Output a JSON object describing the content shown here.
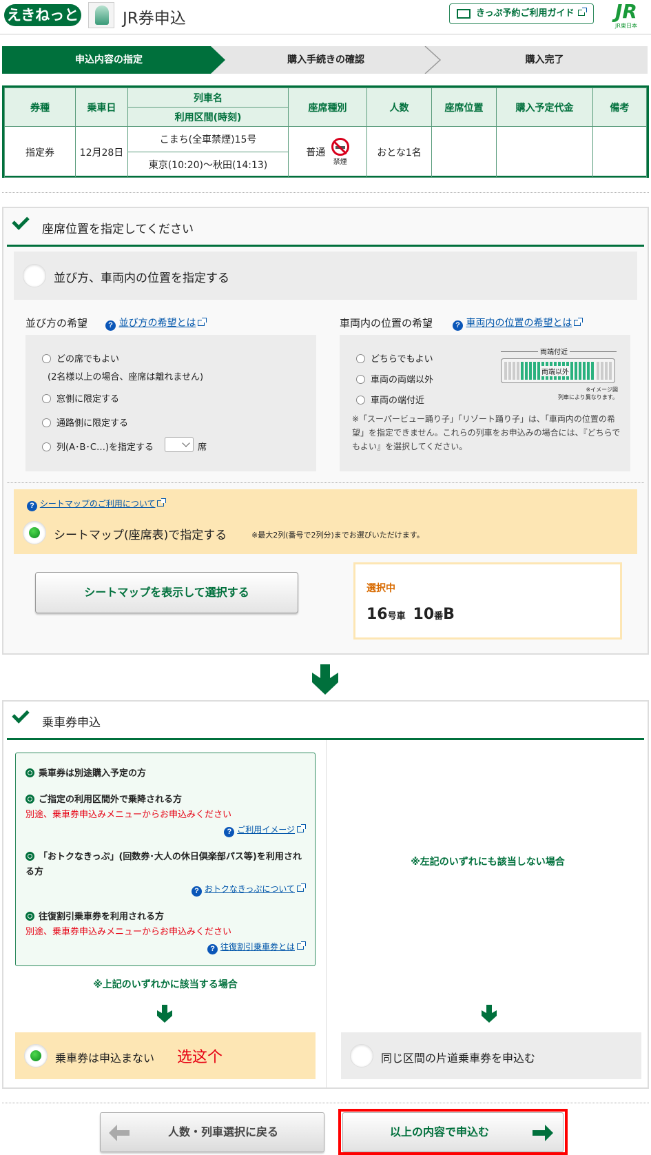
{
  "header": {
    "logo": "えきねっと",
    "title": "JR券申込",
    "guide_button": "きっぷ予約ご利用ガイド",
    "jr_logo": "JR",
    "jr_logo_sub": "JR東日本"
  },
  "steps": [
    "申込内容の指定",
    "購入手続きの確認",
    "購入完了"
  ],
  "ticket_table": {
    "headers": {
      "type": "券種",
      "date": "乗車日",
      "train": "列車名",
      "section": "利用区間(時刻)",
      "seat_class": "座席種別",
      "people": "人数",
      "seat_pos": "座席位置",
      "price": "購入予定代金",
      "note": "備考"
    },
    "row": {
      "type": "指定券",
      "date": "12月28日",
      "train": "こまち(全車禁煙)15号",
      "section": "東京(10:20)～秋田(14:13)",
      "seat_class": "普通",
      "smoking": "禁煙",
      "people": "おとな1名"
    }
  },
  "seat_section": {
    "title": "座席位置を指定してください",
    "option_arrange": "並び方、車両内の位置を指定する",
    "arrange_label": "並び方の希望",
    "arrange_link": "並び方の希望とは",
    "arrange_options": [
      "どの席でもよい",
      "(2名様以上の場合、座席は離れません)",
      "窓側に限定する",
      "通路側に限定する",
      "列(A･B･C…)を指定する"
    ],
    "seat_suffix": "席",
    "position_label": "車両内の位置の希望",
    "position_link": "車両内の位置の希望とは",
    "position_options": [
      "どちらでもよい",
      "車両の両端以外",
      "車両の端付近"
    ],
    "diagram_top": "両端付近",
    "diagram_mid": "両端以外",
    "diagram_note1": "※イメージ図",
    "diagram_note2": "列車により異なります。",
    "position_note": "※「スーパービュー踊り子」「リゾート踊り子」は、「車両内の位置の希望」を指定できません。これらの列車をお申込みの場合には、『どちらでもよい』を選択してください。",
    "seatmap_link": "シートマップのご利用について",
    "option_seatmap": "シートマップ(座席表)で指定する",
    "seatmap_note": "※最大2列(番号で2列分)までお選びいただけます。",
    "seatmap_button": "シートマップを表示して選択する",
    "selected_label": "選択中",
    "selected_car_num": "16",
    "selected_car_unit": "号車",
    "selected_seat_num": "10",
    "selected_seat_unit": "番",
    "selected_seat_letter": "B"
  },
  "ticket_section": {
    "title": "乗車券申込",
    "items": [
      {
        "text": "乗車券は別途購入予定の方"
      },
      {
        "text": "ご指定の利用区間外で乗降される方",
        "warn": "別途、乗車券申込みメニューからお申込みください",
        "link": "ご利用イメージ"
      },
      {
        "text": "「おトクなきっぷ」(回数券･大人の休日倶楽部パス等)を利用される方",
        "link": "おトクなきっぷについて"
      },
      {
        "text": "往復割引乗車券を利用される方",
        "warn": "別途、乗車券申込みメニューからお申込みください",
        "link": "往復割引乗車券とは"
      }
    ],
    "left_caption": "※上記のいずれかに該当する場合",
    "right_caption": "※左記のいずれにも該当しない場合",
    "option_no": "乗車券は申込まない",
    "annotation": "选这个",
    "option_yes": "同じ区間の片道乗車券を申込む"
  },
  "footer": {
    "back_button": "人数・列車選択に戻る",
    "submit_button": "以上の内容で申込む"
  }
}
